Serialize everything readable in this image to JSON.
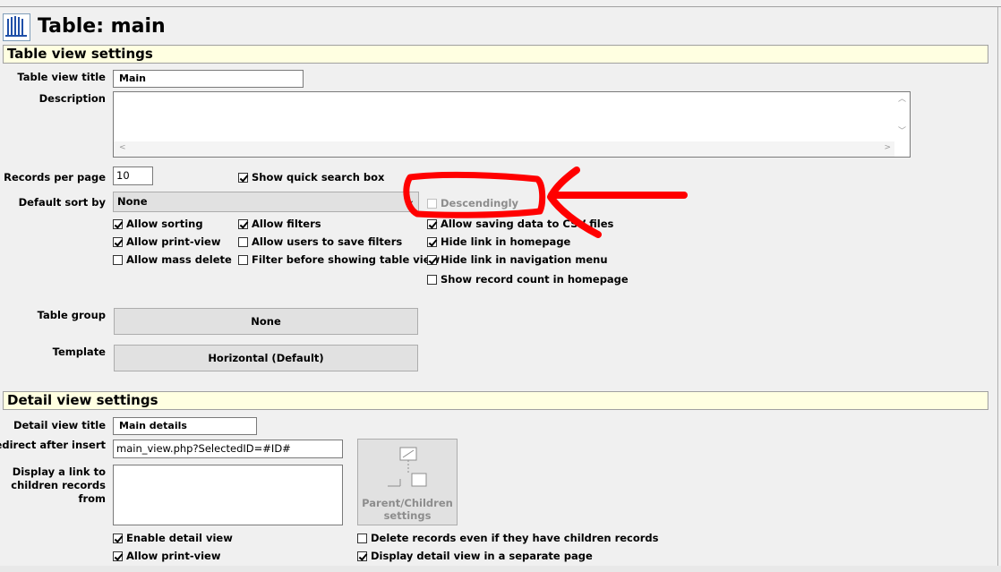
{
  "title": "Table: main",
  "table_view": {
    "header": "Table view settings",
    "title_label": "Table view title",
    "title_value": "Main",
    "description_label": "Description",
    "description_value": "",
    "records_label": "Records per page",
    "records_value": "10",
    "show_quick_search": {
      "label": "Show quick search box",
      "checked": true
    },
    "sort_label": "Default sort by",
    "sort_value": "None",
    "descendingly": {
      "label": "Descendingly",
      "checked": false,
      "disabled": true
    },
    "checkboxes": [
      {
        "label": "Allow sorting",
        "checked": true
      },
      {
        "label": "Allow filters",
        "checked": true
      },
      {
        "label": "Allow saving data to CSV files",
        "checked": true
      },
      {
        "label": "Allow print-view",
        "checked": true
      },
      {
        "label": "Allow users to save filters",
        "checked": false
      },
      {
        "label": "Hide link in homepage",
        "checked": true
      },
      {
        "label": "Allow mass delete",
        "checked": false
      },
      {
        "label": "Filter before showing table view",
        "checked": false
      },
      {
        "label": "Hide link in navigation menu",
        "checked": true
      },
      {
        "label": "Show record count in homepage",
        "checked": false
      }
    ],
    "group_label": "Table group",
    "group_value": "None",
    "template_label": "Template",
    "template_value": "Horizontal (Default)"
  },
  "detail_view": {
    "header": "Detail view settings",
    "title_label": "Detail view title",
    "title_value": "Main details",
    "redirect_label": "Redirect after insert",
    "redirect_value": "main_view.php?SelectedID=#ID#",
    "children_label": "Display a link to children records from",
    "parent_children_button": "Parent/Children settings",
    "checkboxes": [
      {
        "label": "Enable detail view",
        "checked": true
      },
      {
        "label": "Delete records even if they have children records",
        "checked": false
      },
      {
        "label": "Allow print-view",
        "checked": true
      },
      {
        "label": "Display detail view in a separate page",
        "checked": true
      }
    ]
  },
  "colors": {
    "section_bg": "#ffffe1",
    "annotation": "#ff0000"
  }
}
